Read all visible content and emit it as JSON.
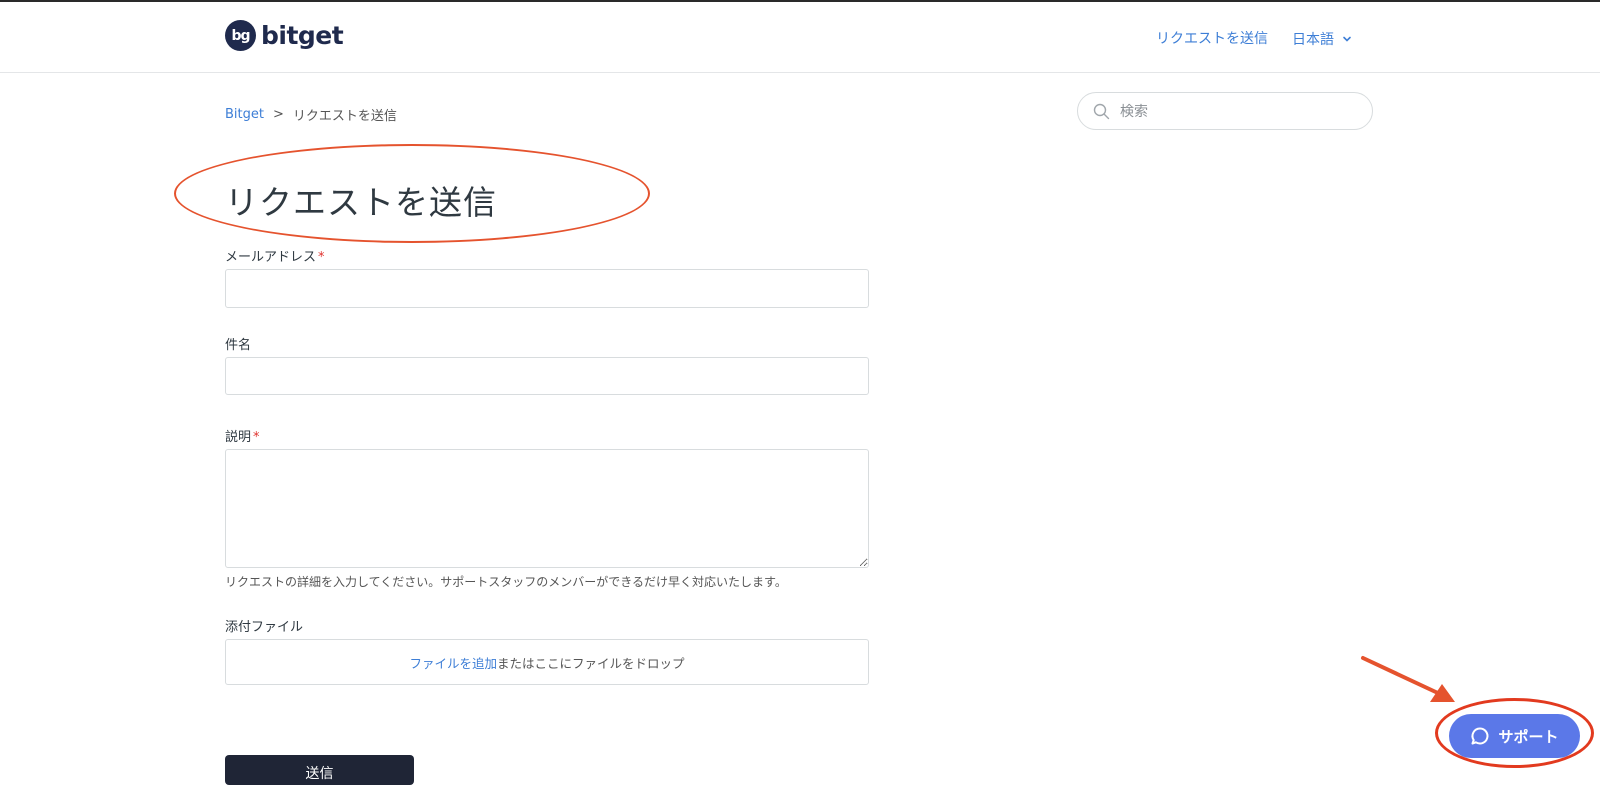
{
  "header": {
    "logo_mark": "bg",
    "logo_text": "bitget",
    "submit_request_link": "リクエストを送信",
    "language": "日本語"
  },
  "breadcrumb": {
    "home": "Bitget",
    "separator": ">",
    "current": "リクエストを送信"
  },
  "search": {
    "placeholder": "検索"
  },
  "page": {
    "title": "リクエストを送信"
  },
  "form": {
    "email_label": "メールアドレス",
    "subject_label": "件名",
    "description_label": "説明",
    "required_mark": "*",
    "description_hint": "リクエストの詳細を入力してください。サポートスタッフのメンバーができるだけ早く対応いたします。",
    "attachments_label": "添付ファイル",
    "add_file_link": "ファイルを追加",
    "drop_text": "またはここにファイルをドロップ",
    "submit_label": "送信"
  },
  "support_widget": {
    "label": "サポート"
  },
  "colors": {
    "link": "#3d7ed6",
    "brand": "#1f2a4d",
    "support": "#5b78e8",
    "annotation": "#e5532e",
    "required": "#e0322e"
  }
}
